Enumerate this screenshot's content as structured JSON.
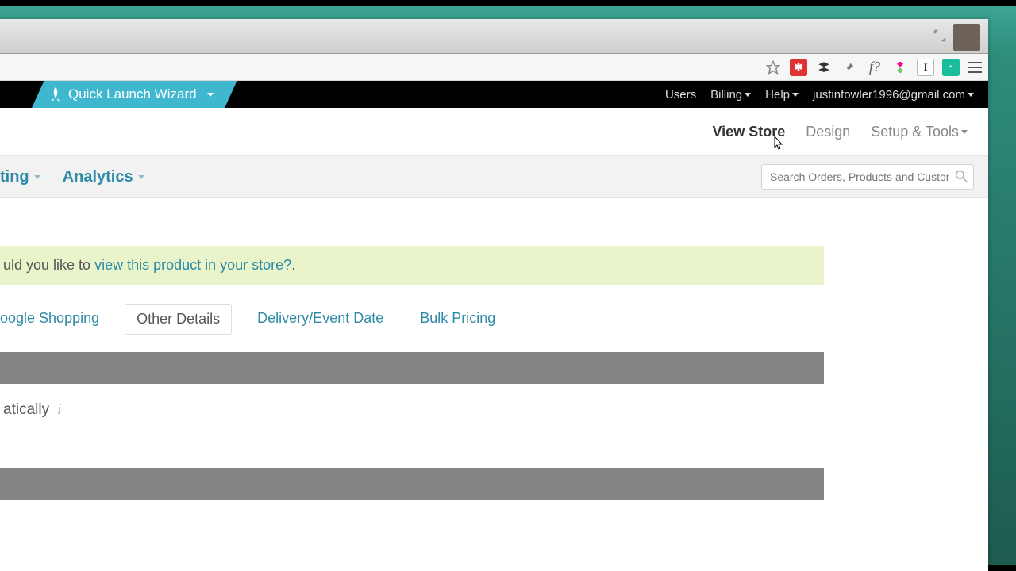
{
  "launch_wizard": "Quick Launch Wizard",
  "topbar": {
    "users": "Users",
    "billing": "Billing",
    "help": "Help",
    "email": "justinfowler1996@gmail.com"
  },
  "nav": {
    "view_store": "View Store",
    "design": "Design",
    "setup": "Setup & Tools"
  },
  "subnav": {
    "partial": "ting",
    "analytics": "Analytics"
  },
  "search": {
    "placeholder": "Search Orders, Products and Customers"
  },
  "alert": {
    "prefix": "uld you like to ",
    "link": "view this product in your store?",
    "suffix": "."
  },
  "tabs": {
    "google": "oogle Shopping",
    "other": "Other Details",
    "delivery": "Delivery/Event Date",
    "bulk": "Bulk Pricing"
  },
  "option": "atically"
}
